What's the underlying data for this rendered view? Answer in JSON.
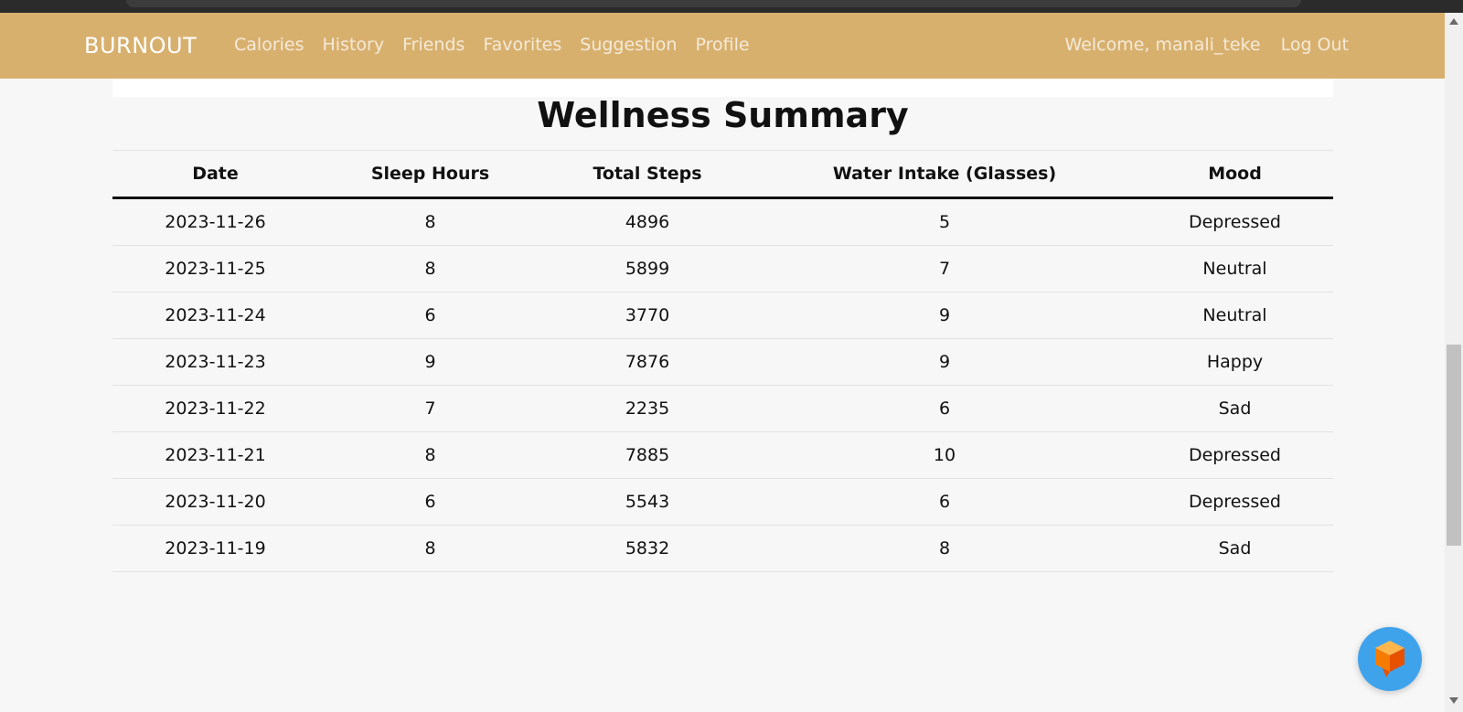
{
  "navbar": {
    "brand": "BURNOUT",
    "links": [
      "Calories",
      "History",
      "Friends",
      "Favorites",
      "Suggestion",
      "Profile"
    ],
    "welcome": "Welcome, manali_teke",
    "logout": "Log Out"
  },
  "title": "Wellness Summary",
  "table": {
    "headers": [
      "Date",
      "Sleep Hours",
      "Total Steps",
      "Water Intake (Glasses)",
      "Mood"
    ],
    "rows": [
      [
        "2023-11-26",
        "8",
        "4896",
        "5",
        "Depressed"
      ],
      [
        "2023-11-25",
        "8",
        "5899",
        "7",
        "Neutral"
      ],
      [
        "2023-11-24",
        "6",
        "3770",
        "9",
        "Neutral"
      ],
      [
        "2023-11-23",
        "9",
        "7876",
        "9",
        "Happy"
      ],
      [
        "2023-11-22",
        "7",
        "2235",
        "6",
        "Sad"
      ],
      [
        "2023-11-21",
        "8",
        "7885",
        "10",
        "Depressed"
      ],
      [
        "2023-11-20",
        "6",
        "5543",
        "6",
        "Depressed"
      ],
      [
        "2023-11-19",
        "8",
        "5832",
        "8",
        "Sad"
      ]
    ]
  },
  "colors": {
    "navbar_bg": "#d8b06e",
    "chat_button": "#3fa3ec",
    "chat_icon": "#f57c00"
  },
  "icons": {
    "chat": "chat-cube-icon"
  }
}
